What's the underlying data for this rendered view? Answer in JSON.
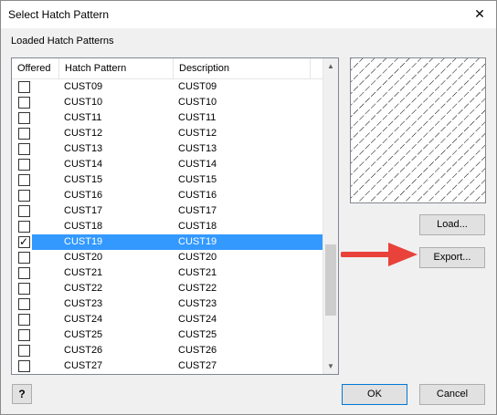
{
  "window": {
    "title": "Select Hatch Pattern"
  },
  "group_label": "Loaded Hatch Patterns",
  "columns": [
    "Offered",
    "Hatch Pattern",
    "Description"
  ],
  "rows": [
    {
      "name": "CUST09",
      "description": "CUST09",
      "checked": false
    },
    {
      "name": "CUST10",
      "description": "CUST10",
      "checked": false
    },
    {
      "name": "CUST11",
      "description": "CUST11",
      "checked": false
    },
    {
      "name": "CUST12",
      "description": "CUST12",
      "checked": false
    },
    {
      "name": "CUST13",
      "description": "CUST13",
      "checked": false
    },
    {
      "name": "CUST14",
      "description": "CUST14",
      "checked": false
    },
    {
      "name": "CUST15",
      "description": "CUST15",
      "checked": false
    },
    {
      "name": "CUST16",
      "description": "CUST16",
      "checked": false
    },
    {
      "name": "CUST17",
      "description": "CUST17",
      "checked": false
    },
    {
      "name": "CUST18",
      "description": "CUST18",
      "checked": false
    },
    {
      "name": "CUST19",
      "description": "CUST19",
      "checked": true,
      "selected": true
    },
    {
      "name": "CUST20",
      "description": "CUST20",
      "checked": false
    },
    {
      "name": "CUST21",
      "description": "CUST21",
      "checked": false
    },
    {
      "name": "CUST22",
      "description": "CUST22",
      "checked": false
    },
    {
      "name": "CUST23",
      "description": "CUST23",
      "checked": false
    },
    {
      "name": "CUST24",
      "description": "CUST24",
      "checked": false
    },
    {
      "name": "CUST25",
      "description": "CUST25",
      "checked": false
    },
    {
      "name": "CUST26",
      "description": "CUST26",
      "checked": false
    },
    {
      "name": "CUST27",
      "description": "CUST27",
      "checked": false
    }
  ],
  "buttons": {
    "load": "Load...",
    "export": "Export...",
    "ok": "OK",
    "cancel": "Cancel",
    "help": "?"
  },
  "icons": {
    "close": "close-icon",
    "help": "help-icon",
    "arrow": "red-arrow-icon",
    "scroll_up": "chevron-up-icon",
    "scroll_down": "chevron-down-icon"
  },
  "colors": {
    "selection": "#3399ff",
    "arrow": "#e8423a",
    "focus_border": "#0078d7"
  }
}
